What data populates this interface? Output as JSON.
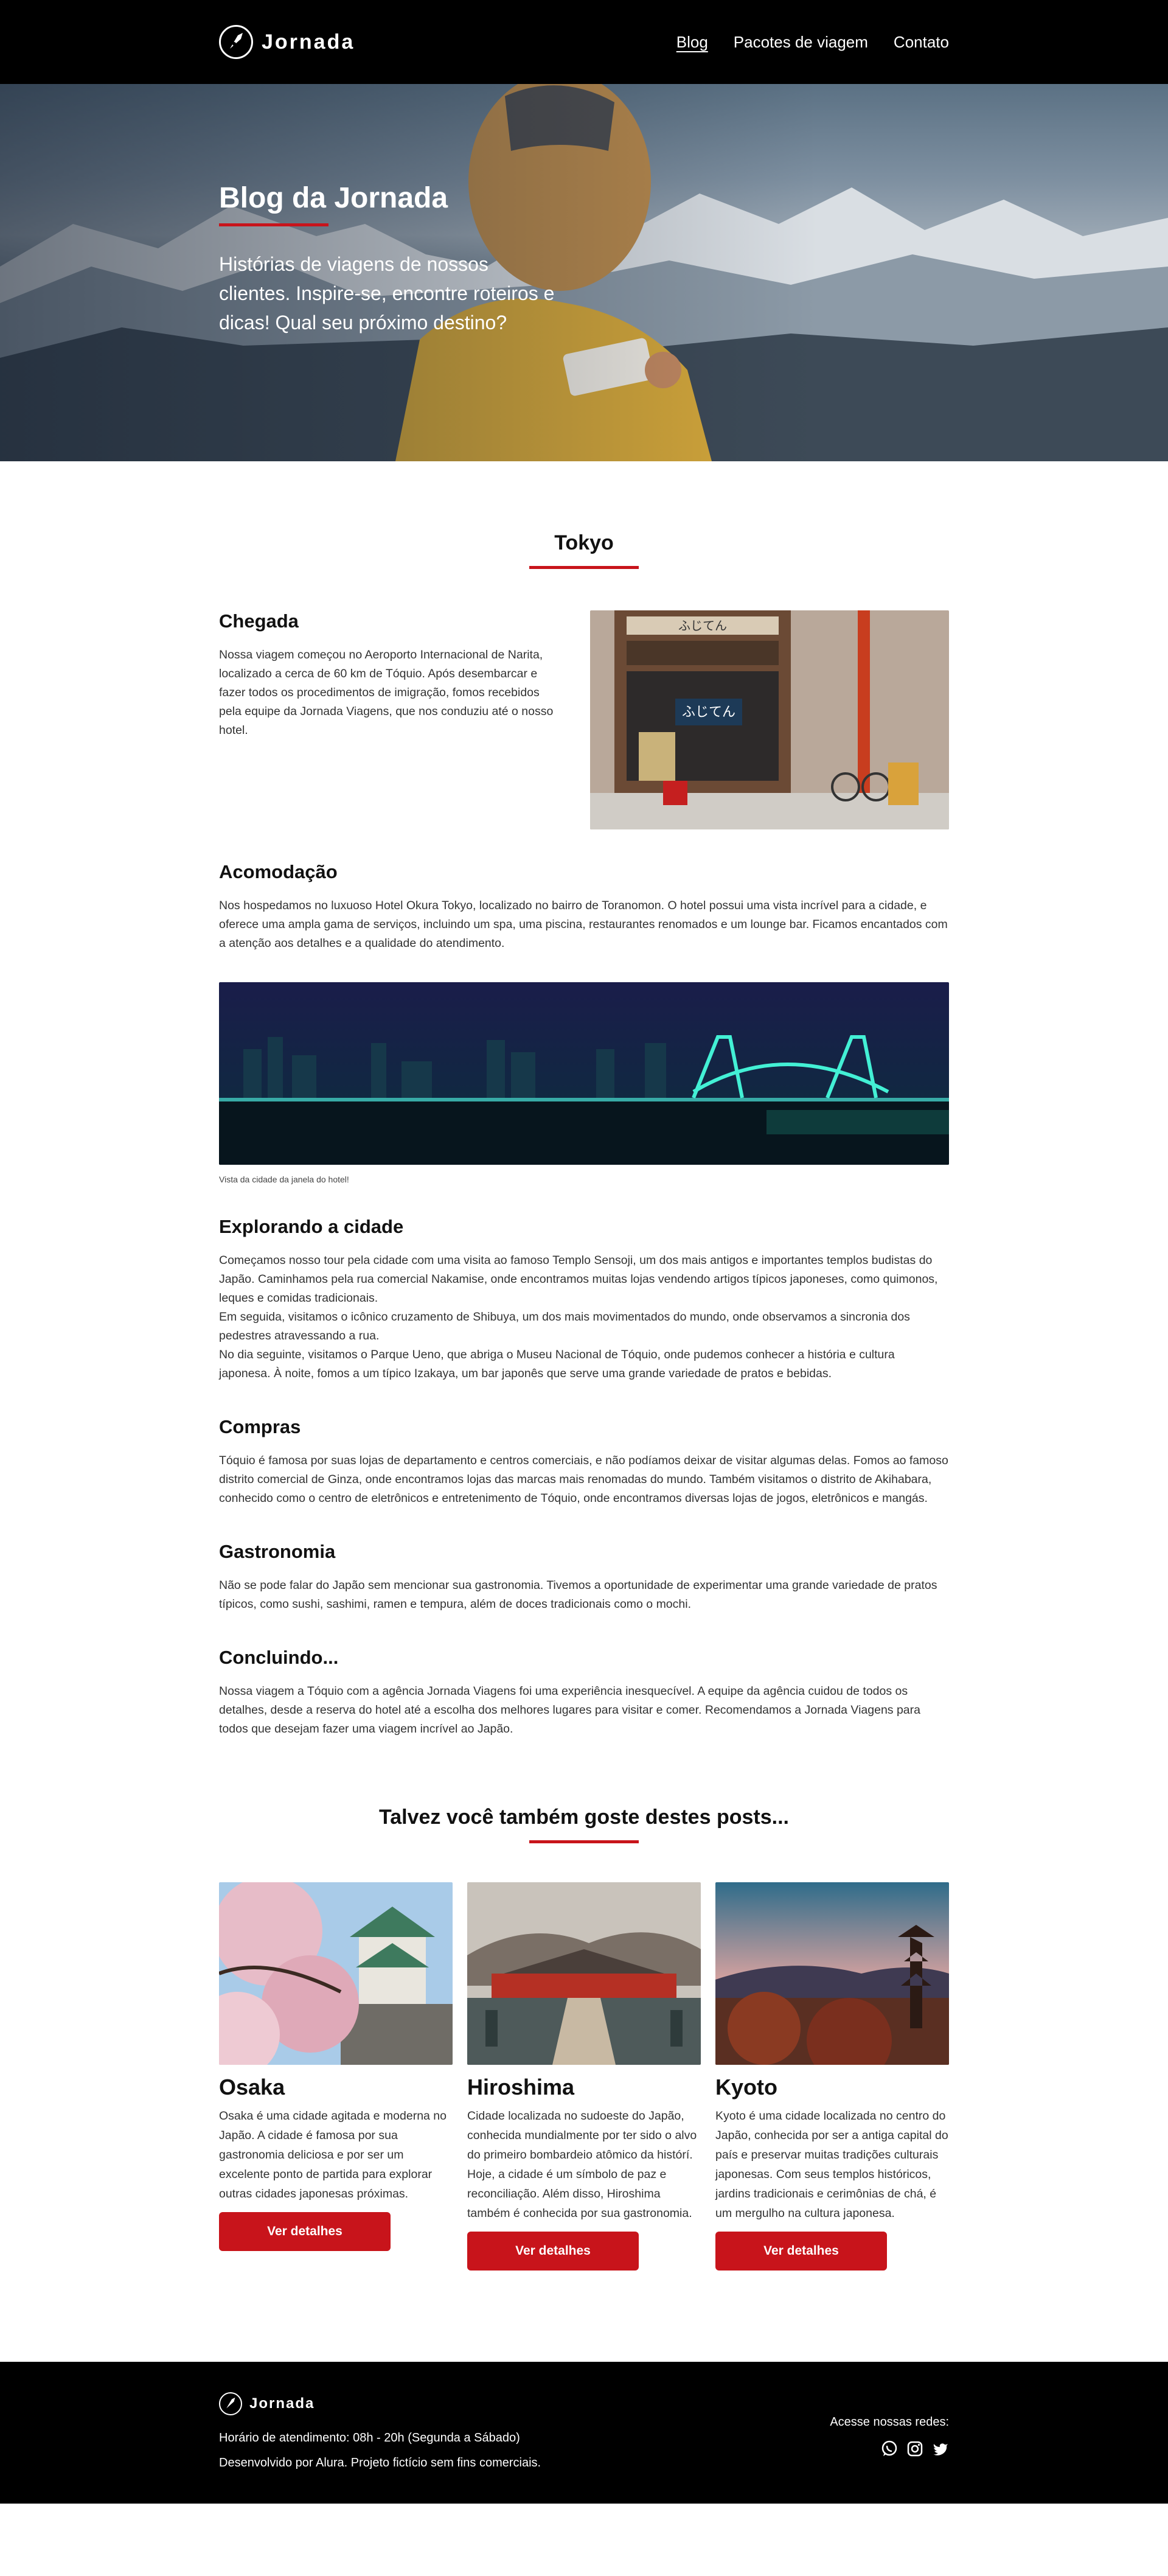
{
  "header": {
    "brand": "Jornada",
    "nav": [
      {
        "label": "Blog"
      },
      {
        "label": "Pacotes de viagem"
      },
      {
        "label": "Contato"
      }
    ]
  },
  "hero": {
    "title": "Blog da Jornada",
    "subtitle": "Histórias de viagens de nossos clientes. Inspire-se, encontre roteiros e dicas! Qual seu próximo destino?"
  },
  "article": {
    "title": "Tokyo",
    "sections": [
      {
        "heading": "Chegada",
        "text": "Nossa viagem começou no Aeroporto Internacional de Narita, localizado a cerca de 60 km de Tóquio. Após desembarcar e fazer todos os procedimentos de imigração, fomos recebidos pela equipe da Jornada Viagens, que nos conduziu até o nosso hotel."
      },
      {
        "heading": "Acomodação",
        "text": "Nos hospedamos no luxuoso Hotel Okura Tokyo, localizado no bairro de Toranomon. O hotel possui uma vista incrível para a cidade, e oferece uma ampla gama de serviços, incluindo um spa, uma piscina, restaurantes renomados e um lounge bar. Ficamos encantados com a atenção aos detalhes e a qualidade do atendimento."
      },
      {
        "heading": "Explorando a cidade",
        "text1": "Começamos nosso tour pela cidade com uma visita ao famoso Templo Sensoji, um dos mais antigos e importantes templos budistas do Japão. Caminhamos pela rua comercial Nakamise, onde encontramos muitas lojas vendendo artigos típicos japoneses, como quimonos, leques e comidas tradicionais.",
        "text2": "Em seguida, visitamos o icônico cruzamento de Shibuya, um dos mais movimentados do mundo, onde observamos a sincronia dos pedestres atravessando a rua.",
        "text3": "No dia seguinte, visitamos o Parque Ueno, que abriga o Museu Nacional de Tóquio, onde pudemos conhecer a história e cultura japonesa. À noite, fomos a um típico Izakaya, um bar japonês que serve uma grande variedade de pratos e bebidas."
      },
      {
        "heading": "Compras",
        "text": "Tóquio é famosa por suas lojas de departamento e centros comerciais, e não podíamos deixar de visitar algumas delas. Fomos ao famoso distrito comercial de Ginza, onde encontramos lojas das marcas mais renomadas do mundo. Também visitamos o distrito de Akihabara, conhecido como o centro de eletrônicos e entretenimento de Tóquio, onde encontramos diversas lojas de jogos, eletrônicos e mangás."
      },
      {
        "heading": "Gastronomia",
        "text": "Não se pode falar do Japão sem mencionar sua gastronomia. Tivemos a oportunidade de experimentar uma grande variedade de pratos típicos, como sushi, sashimi, ramen e tempura, além de doces tradicionais como o mochi."
      },
      {
        "heading": "Concluindo...",
        "text": "Nossa viagem a Tóquio com a agência Jornada Viagens foi uma experiência inesquecível. A equipe da agência cuidou de todos os detalhes, desde a reserva do hotel até a escolha dos melhores lugares para visitar e comer. Recomendamos a Jornada Viagens para todos que desejam fazer uma viagem incrível ao Japão."
      }
    ],
    "image_caption": "Vista da cidade da janela do hotel!",
    "shop_sign": "ふじてん"
  },
  "related": {
    "title": "Talvez você também goste destes posts...",
    "cards": [
      {
        "title": "Osaka",
        "text": "Osaka é uma cidade agitada e moderna no Japão. A cidade é famosa por sua gastronomia deliciosa e por ser um excelente ponto de partida para explorar outras cidades japonesas próximas.",
        "button": "Ver detalhes"
      },
      {
        "title": "Hiroshima",
        "text": "Cidade localizada no sudoeste do Japão, conhecida mundialmente por ter sido o alvo do primeiro bombardeio atômico da histórí. Hoje, a cidade é um símbolo de paz e reconciliação. Além disso, Hiroshima também é conhecida por sua gastronomia.",
        "button": "Ver detalhes"
      },
      {
        "title": "Kyoto",
        "text": "Kyoto é uma cidade localizada no centro do Japão, conhecida por ser a antiga capital do país e preservar muitas tradições culturais japonesas. Com seus templos históricos, jardins tradicionais e cerimônias de chá, é um mergulho na cultura japonesa.",
        "button": "Ver detalhes"
      }
    ]
  },
  "footer": {
    "brand": "Jornada",
    "hours": "Horário de atendimento: 08h - 20h (Segunda a Sábado)",
    "credits": "Desenvolvido por Alura. Projeto fictício sem fins comerciais.",
    "social_label": "Acesse nossas redes:",
    "socials": [
      "whatsapp-icon",
      "instagram-icon",
      "twitter-icon"
    ]
  },
  "colors": {
    "accent": "#c8141b",
    "header_bg": "#000000"
  }
}
